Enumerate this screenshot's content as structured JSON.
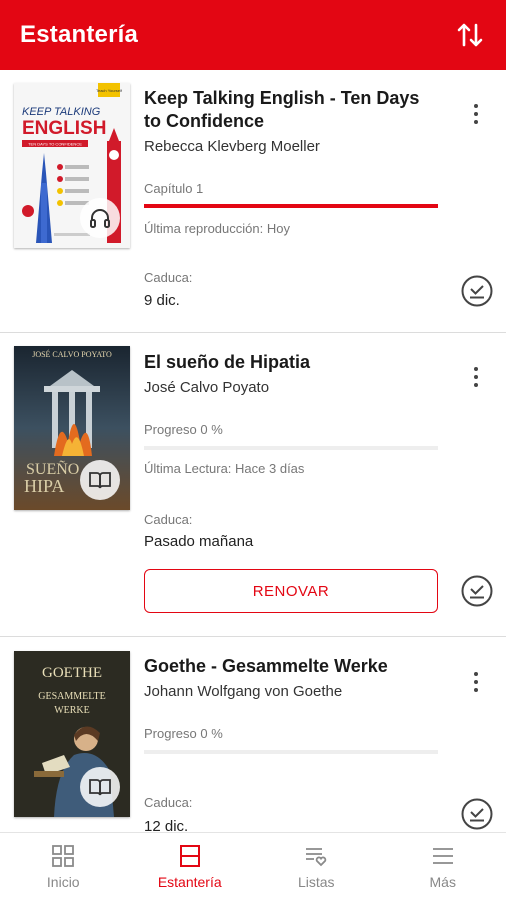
{
  "header": {
    "title": "Estantería",
    "sort_icon": "sort-arrows-icon",
    "background": "#e30613"
  },
  "books": [
    {
      "cover_text": {
        "badge": "Teach Yourself",
        "line1": "KEEP TALKING",
        "line2": "ENGLISH",
        "subtitle": "TEN DAYS TO CONFIDENCE"
      },
      "title": "Keep Talking English - Ten Days to Confidence",
      "author": "Rebecca Klevberg Moeller",
      "status": "Capítulo 1",
      "progress": 1.0,
      "last": "Última reproducción: Hoy",
      "expires_label": "Caduca:",
      "expires_value": "9 dic.",
      "format_icon": "headphones-icon"
    },
    {
      "cover_text": {
        "author": "JOSÉ CALVO POYATO",
        "title1": "SUEÑO",
        "title2": "HIPA"
      },
      "title": "El sueño de Hipatia",
      "author": "José Calvo Poyato",
      "status": "Progreso 0 %",
      "progress": 0,
      "last": "Última Lectura: Hace 3 días",
      "expires_label": "Caduca:",
      "expires_value": "Pasado mañana",
      "renew_label": "RENOVAR",
      "format_icon": "book-icon"
    },
    {
      "cover_text": {
        "name": "GOETHE",
        "sub1": "GESAMMELTE",
        "sub2": "WERKE"
      },
      "title": "Goethe - Gesammelte Werke",
      "author": "Johann Wolfgang von Goethe",
      "status": "Progreso 0 %",
      "progress": 0,
      "expires_label": "Caduca:",
      "expires_value": "12 dic.",
      "format_icon": "book-icon"
    }
  ],
  "nav": [
    {
      "label": "Inicio",
      "icon": "grid-icon",
      "active": false
    },
    {
      "label": "Estantería",
      "icon": "shelf-icon",
      "active": true
    },
    {
      "label": "Listas",
      "icon": "list-heart-icon",
      "active": false
    },
    {
      "label": "Más",
      "icon": "menu-icon",
      "active": false
    }
  ]
}
